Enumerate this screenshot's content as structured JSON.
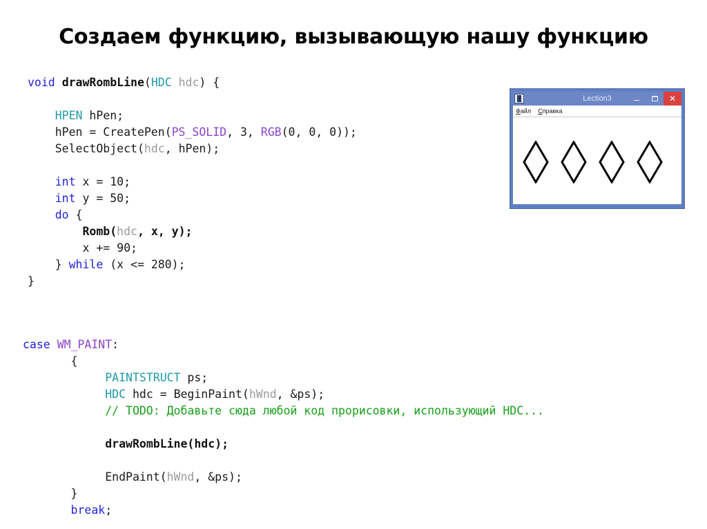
{
  "slide": {
    "title": "Создаем функцию, вызывающую нашу функцию",
    "background": "#ffffff"
  },
  "colors": {
    "keyword": "#2222dd",
    "type": "#1f9aa8",
    "macro": "#8e44c9",
    "param": "#9b9b9b",
    "comment": "#16a018",
    "plain": "#1a1a1a",
    "titlebar": "#6d87c6",
    "window_frame": "#5f7fc4",
    "close_button": "#d9433f"
  },
  "code_top": {
    "lines": [
      [
        {
          "t": "void",
          "c": "kw"
        },
        {
          "t": " ",
          "c": "plain"
        },
        {
          "t": "drawRombLine",
          "c": "fn-bold"
        },
        {
          "t": "(",
          "c": "plain"
        },
        {
          "t": "HDC",
          "c": "type"
        },
        {
          "t": " ",
          "c": "plain"
        },
        {
          "t": "hdc",
          "c": "param"
        },
        {
          "t": ") {",
          "c": "plain"
        }
      ],
      [],
      [
        {
          "t": "    ",
          "c": "plain"
        },
        {
          "t": "HPEN",
          "c": "type"
        },
        {
          "t": " hPen;",
          "c": "plain"
        }
      ],
      [
        {
          "t": "    hPen = CreatePen(",
          "c": "plain"
        },
        {
          "t": "PS_SOLID",
          "c": "macro"
        },
        {
          "t": ", 3, ",
          "c": "plain"
        },
        {
          "t": "RGB",
          "c": "macro"
        },
        {
          "t": "(0, 0, 0));",
          "c": "plain"
        }
      ],
      [
        {
          "t": "    SelectObject(",
          "c": "plain"
        },
        {
          "t": "hdc",
          "c": "param"
        },
        {
          "t": ", hPen);",
          "c": "plain"
        }
      ],
      [],
      [
        {
          "t": "    ",
          "c": "plain"
        },
        {
          "t": "int",
          "c": "kw"
        },
        {
          "t": " x = 10;",
          "c": "plain"
        }
      ],
      [
        {
          "t": "    ",
          "c": "plain"
        },
        {
          "t": "int",
          "c": "kw"
        },
        {
          "t": " y = 50;",
          "c": "plain"
        }
      ],
      [
        {
          "t": "    ",
          "c": "plain"
        },
        {
          "t": "do",
          "c": "kw"
        },
        {
          "t": " {",
          "c": "plain"
        }
      ],
      [
        {
          "t": "        ",
          "c": "plain"
        },
        {
          "t": "Romb(",
          "c": "fn-bold"
        },
        {
          "t": "hdc",
          "c": "param"
        },
        {
          "t": ", x, y);",
          "c": "fn-bold"
        }
      ],
      [
        {
          "t": "        x += 90;",
          "c": "plain"
        }
      ],
      [
        {
          "t": "    } ",
          "c": "plain"
        },
        {
          "t": "while",
          "c": "kw"
        },
        {
          "t": " (x <= 280);",
          "c": "plain"
        }
      ],
      [
        {
          "t": "}",
          "c": "plain"
        }
      ]
    ]
  },
  "code_bottom": {
    "lines": [
      [
        {
          "t": "case",
          "c": "kw"
        },
        {
          "t": " ",
          "c": "plain"
        },
        {
          "t": "WM_PAINT",
          "c": "macro"
        },
        {
          "t": ":",
          "c": "plain"
        }
      ],
      [
        {
          "t": "       {",
          "c": "plain"
        }
      ],
      [
        {
          "t": "            ",
          "c": "plain"
        },
        {
          "t": "PAINTSTRUCT",
          "c": "type"
        },
        {
          "t": " ps;",
          "c": "plain"
        }
      ],
      [
        {
          "t": "            ",
          "c": "plain"
        },
        {
          "t": "HDC",
          "c": "type"
        },
        {
          "t": " hdc = BeginPaint(",
          "c": "plain"
        },
        {
          "t": "hWnd",
          "c": "param"
        },
        {
          "t": ", &ps);",
          "c": "plain"
        }
      ],
      [
        {
          "t": "            // TODO: Добавьте сюда любой код прорисовки, использующий HDC...",
          "c": "comment"
        }
      ],
      [],
      [
        {
          "t": "            ",
          "c": "plain"
        },
        {
          "t": "drawRombLine(hdc);",
          "c": "fn-bold"
        }
      ],
      [],
      [
        {
          "t": "            EndPaint(",
          "c": "plain"
        },
        {
          "t": "hWnd",
          "c": "param"
        },
        {
          "t": ", &ps);",
          "c": "plain"
        }
      ],
      [
        {
          "t": "       }",
          "c": "plain"
        }
      ],
      [
        {
          "t": "       ",
          "c": "plain"
        },
        {
          "t": "break",
          "c": "kw"
        },
        {
          "t": ";",
          "c": "plain"
        }
      ]
    ]
  },
  "app_window": {
    "title": "Lection3",
    "icon": "app-icon",
    "buttons": {
      "minimize": "–",
      "maximize": "□",
      "close": "✕"
    },
    "menu": [
      {
        "mnemonic": "Ф",
        "rest": "айл"
      },
      {
        "mnemonic": "С",
        "rest": "правка"
      }
    ],
    "canvas": {
      "shape": "romb",
      "count": 4,
      "stroke_color": "#000000",
      "stroke_width": 3,
      "positions_x": [
        14,
        69,
        124,
        179
      ],
      "width": 38,
      "height": 62
    }
  }
}
